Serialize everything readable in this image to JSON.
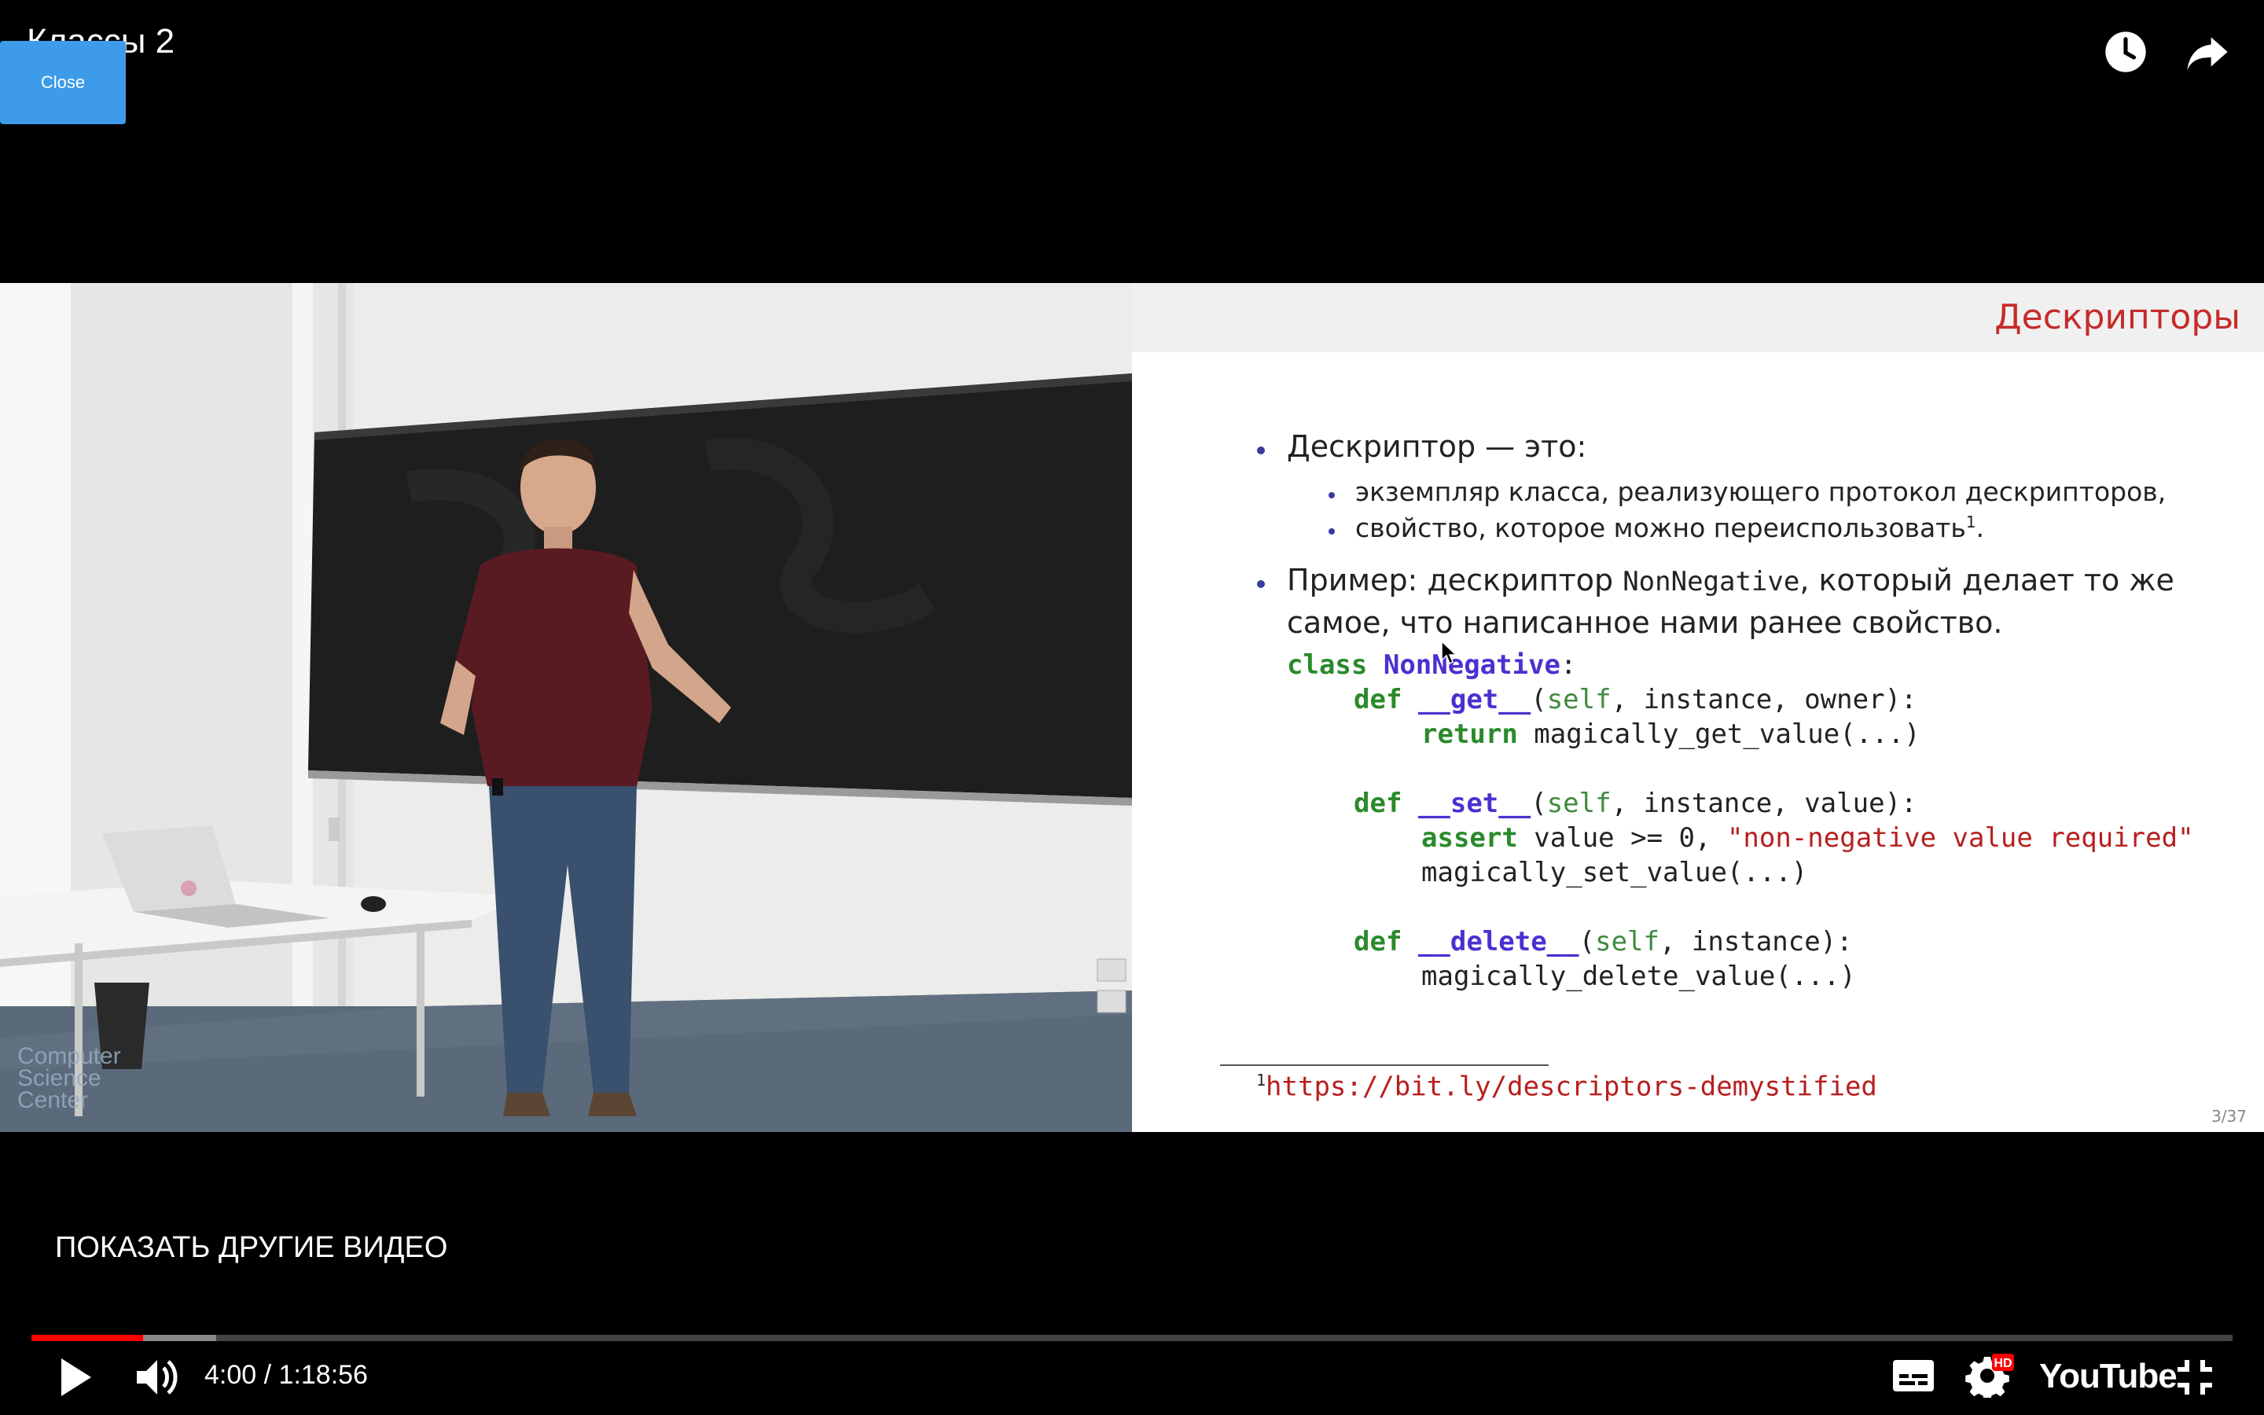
{
  "header": {
    "title": "Классы 2",
    "close_label": "Close"
  },
  "slide": {
    "title": "Дескрипторы",
    "bullet1": "Дескриптор — это:",
    "sub1": "экземпляр класса, реализующего протокол дескрипторов,",
    "sub2": "свойство, которое можно переиспользовать",
    "sub2_sup": "1",
    "sub2_end": ".",
    "bullet2_a": "Пример: дескриптор ",
    "bullet2_code": "NonNegative",
    "bullet2_b": ", который делает то же",
    "bullet2_line2": "самое, что написанное нами ранее свойство.",
    "code": {
      "l1_kw": "class",
      "l1_name": "NonNegative",
      "l1_end": ":",
      "l2_kw": "def",
      "l2_fn": "__get__",
      "l2_self": "self",
      "l2_rest": ", instance, owner):",
      "l3_kw": "return",
      "l3_rest": " magically_get_value(...)",
      "l4_kw": "def",
      "l4_fn": "__set__",
      "l4_self": "self",
      "l4_rest": ", instance, value):",
      "l5_kw": "assert",
      "l5_mid": " value >= 0, ",
      "l5_str": "\"non-negative value required\"",
      "l6": "magically_set_value(...)",
      "l7_kw": "def",
      "l7_fn": "__delete__",
      "l7_self": "self",
      "l7_rest": ", instance):",
      "l8": "magically_delete_value(...)"
    },
    "footnote_sup": "1",
    "footnote": "https://bit.ly/descriptors-demystified",
    "page": "3/37"
  },
  "watermark": [
    "Computer",
    "Science",
    "Center"
  ],
  "more_videos": "ПОКАЗАТЬ ДРУГИЕ ВИДЕО",
  "player": {
    "current_time": "4:00",
    "separator": " / ",
    "duration": "1:18:56",
    "progress_played": 0.0507,
    "progress_buffered": 0.0838,
    "logo": "YouTube",
    "hd_badge": "HD"
  },
  "icons": [
    "clock-icon",
    "share-icon",
    "play-icon",
    "volume-icon",
    "subtitles-icon",
    "settings-icon",
    "exit-fullscreen-icon"
  ],
  "colors": {
    "accent": "#ff0000",
    "close_button": "#3d9be9",
    "slide_title": "#c62b2b",
    "keyword": "#2a8a2a",
    "class_name": "#4d2fd0",
    "string": "#b81e1e"
  }
}
